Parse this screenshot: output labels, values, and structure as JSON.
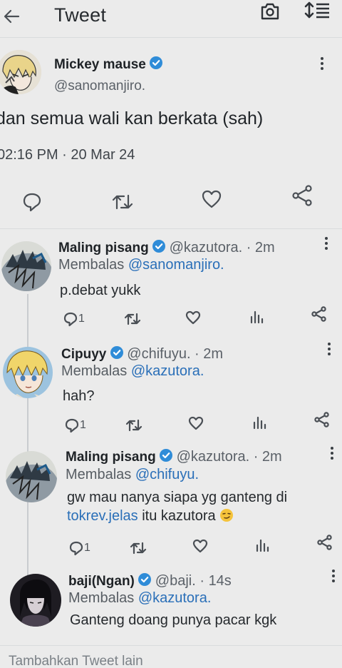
{
  "header": {
    "title": "Tweet"
  },
  "main_tweet": {
    "name": "Mickey mause",
    "handle": "@sanomanjiro.",
    "text": "dan semua wali kan berkata (sah)",
    "datetime": "02:16 PM · 20 Mar 24"
  },
  "replies": [
    {
      "name": "Maling pisang",
      "meta": "@kazutora. · 2m",
      "reply_prefix": "Membalas ",
      "reply_to": "@sanomanjiro.",
      "text": "p.debat yukk",
      "reply_count": "1"
    },
    {
      "name": "Cipuyy",
      "meta": "@chifuyu. · 2m",
      "reply_prefix": "Membalas ",
      "reply_to": "@kazutora.",
      "text": "hah?",
      "reply_count": "1"
    },
    {
      "name": "Maling pisang",
      "meta": "@kazutora. · 2m",
      "reply_prefix": "Membalas ",
      "reply_to": "@chifuyu.",
      "text_line1": "gw mau nanya siapa yg ganteng di",
      "text_link": "tokrev.jelas",
      "text_line2_rest": " itu kazutora",
      "reply_count": "1"
    },
    {
      "name": "baji(Ngan)",
      "meta": "@baji. · 14s",
      "reply_prefix": "Membalas ",
      "reply_to": "@kazutora.",
      "text": "Ganteng doang punya pacar kgk"
    }
  ],
  "composer": {
    "placeholder": "Tambahkan Tweet lain"
  },
  "colors": {
    "verified": "#2f8cd8",
    "link": "#2a6fb8",
    "background": "#ebebeb"
  }
}
